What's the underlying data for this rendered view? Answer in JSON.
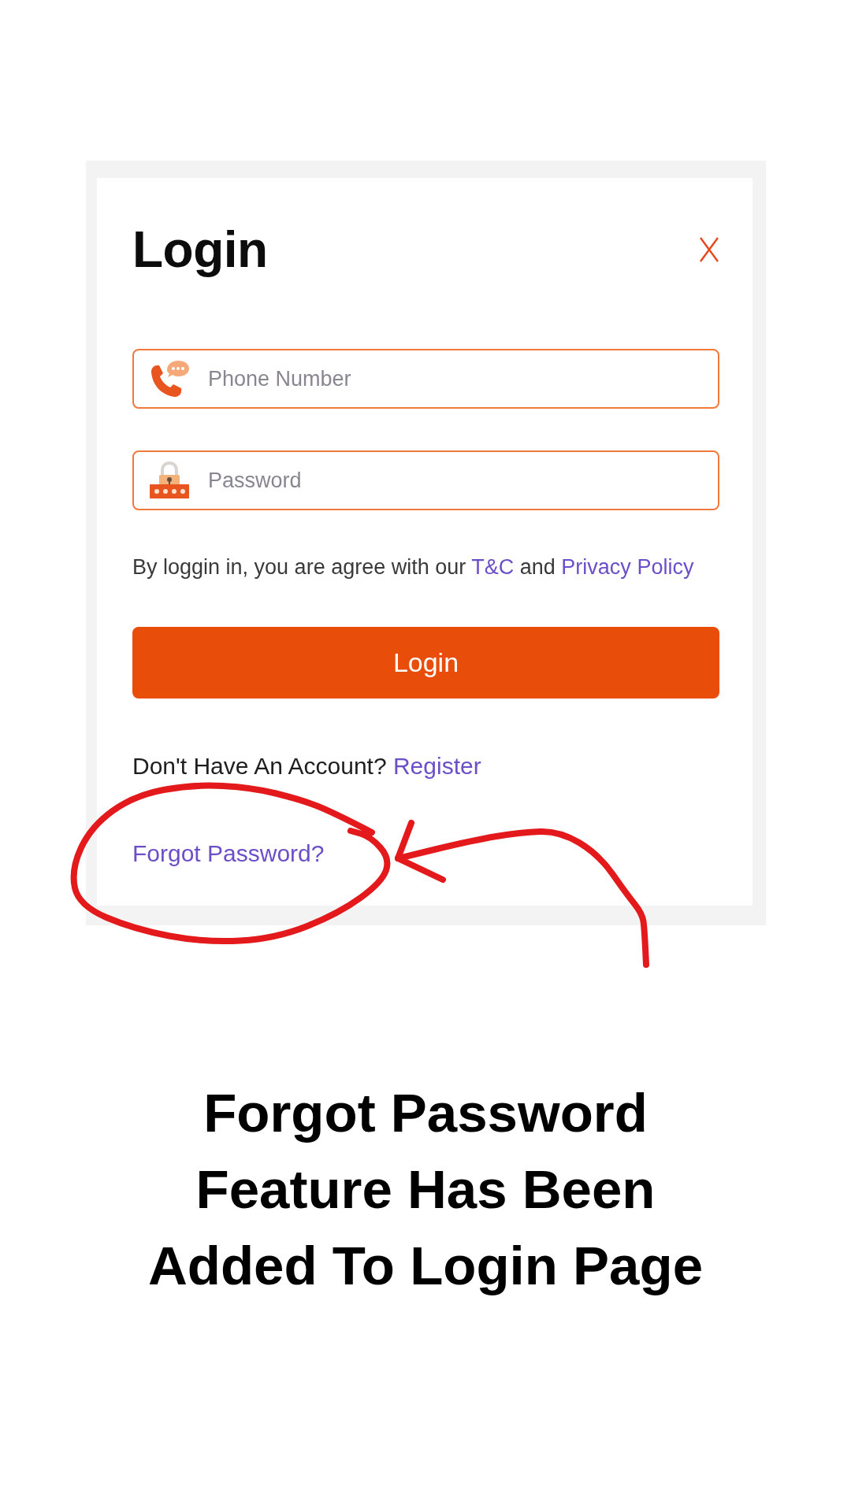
{
  "dialog": {
    "title": "Login"
  },
  "fields": [
    {
      "kind": "phone",
      "placeholder": "Phone Number"
    },
    {
      "kind": "password",
      "placeholder": "Password"
    }
  ],
  "terms": [
    {
      "kind": "text",
      "text": "By loggin in, you are agree with our"
    },
    {
      "kind": "link",
      "text": "T&C"
    },
    {
      "kind": "text",
      "text": "and"
    },
    {
      "kind": "link",
      "text": "Privacy Policy"
    }
  ],
  "login_button": "Login",
  "register": {
    "prompt": "Don't Have An Account?",
    "link": "Register"
  },
  "forgot_password": "Forgot Password?",
  "caption": "Forgot Password Feature Has Been Added To Login Page"
}
